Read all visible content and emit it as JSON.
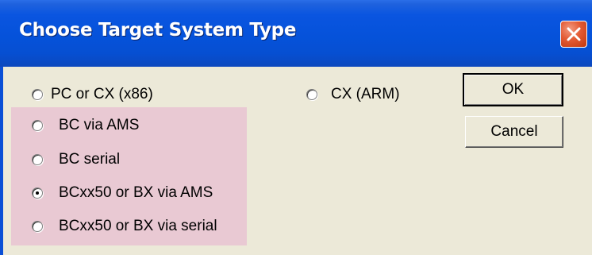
{
  "dialog": {
    "title": "Choose Target System Type",
    "close_icon": "close-icon",
    "highlight_color": "#e9c9d3"
  },
  "options": {
    "pc_cx_x86": {
      "label": "PC or CX (x86)",
      "selected": false
    },
    "cx_arm": {
      "label": "CX (ARM)",
      "selected": false
    },
    "bc_via_ams": {
      "label": "BC via AMS",
      "selected": false
    },
    "bc_serial": {
      "label": "BC serial",
      "selected": false
    },
    "bcxx50_bx_via_ams": {
      "label": "BCxx50 or BX via AMS",
      "selected": true
    },
    "bcxx50_bx_via_serial": {
      "label": "BCxx50 or BX via serial",
      "selected": false
    }
  },
  "buttons": {
    "ok_label": "OK",
    "cancel_label": "Cancel"
  }
}
